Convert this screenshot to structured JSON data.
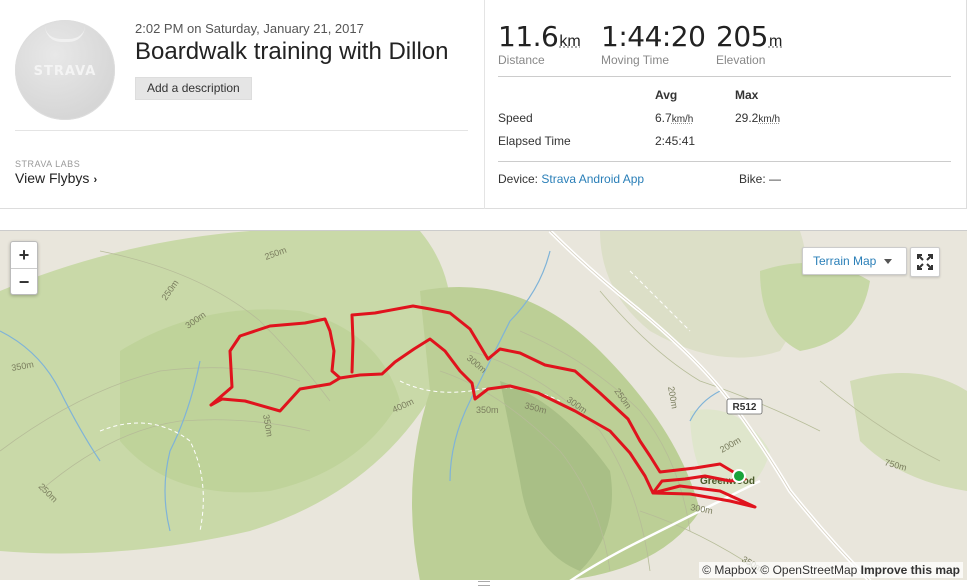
{
  "activity": {
    "date_time": "2:02 PM on Saturday, January 21, 2017",
    "title": "Boardwalk training with Dillon",
    "description_button": "Add a description",
    "avatar_logo": "STRAVA"
  },
  "labs": {
    "label": "STRAVA LABS",
    "flybys_link": "View Flybys"
  },
  "stats": {
    "distance": {
      "value": "11.6",
      "unit": "km",
      "label": "Distance"
    },
    "moving_time": {
      "value": "1:44:20",
      "label": "Moving Time"
    },
    "elevation": {
      "value": "205",
      "unit": "m",
      "label": "Elevation"
    }
  },
  "details": {
    "headers": {
      "avg": "Avg",
      "max": "Max"
    },
    "speed": {
      "label": "Speed",
      "avg": "6.7",
      "max": "29.2",
      "unit": "km/h"
    },
    "elapsed": {
      "label": "Elapsed Time",
      "avg": "2:45:41"
    }
  },
  "device": {
    "label": "Device:",
    "value": "Strava Android App",
    "bike_label": "Bike:",
    "bike_value": "—"
  },
  "map": {
    "zoom_in": "+",
    "zoom_out": "−",
    "map_type": "Terrain Map",
    "route_color": "#e0131d",
    "start_color": "#19a33a",
    "labels": {
      "contours": [
        "250m",
        "250m",
        "300m",
        "350m",
        "400m",
        "300m",
        "350m",
        "350m",
        "300m",
        "250m",
        "200m",
        "200m",
        "300m",
        "350m",
        "750m",
        "250m",
        "350m"
      ],
      "road": "R512",
      "place": "Greenwood"
    },
    "attribution": {
      "mapbox": "© Mapbox",
      "osm": "© OpenStreetMap",
      "improve": "Improve this map"
    }
  }
}
